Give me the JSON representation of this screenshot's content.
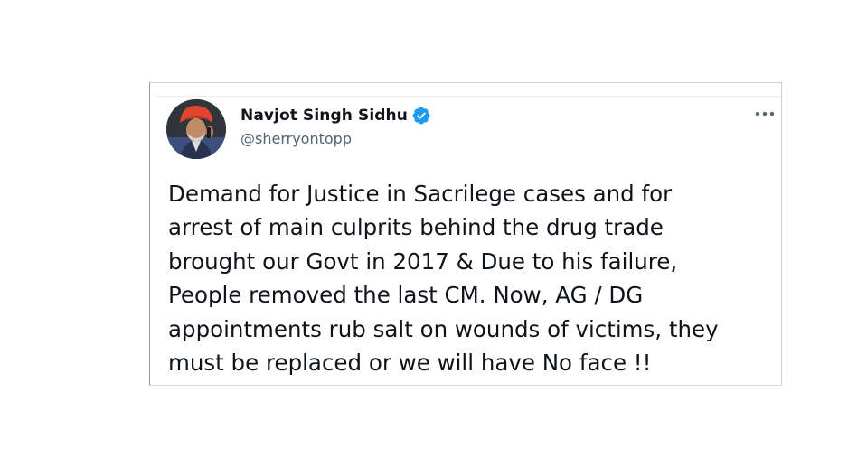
{
  "tweet": {
    "display_name": "Navjot Singh Sidhu",
    "handle": "@sherryontopp",
    "verified": true,
    "lines": [
      "Demand for Justice in Sacrilege cases and for",
      "arrest of main culprits behind the drug trade",
      "brought our Govt in 2017 & Due to his failure,",
      "People removed the last CM. Now, AG / DG",
      "appointments rub salt on wounds of victims, they",
      "must be replaced or we will have No face !!"
    ]
  },
  "icons": {
    "verified": "verified-badge-icon",
    "more": "more-dots-icon"
  },
  "colors": {
    "verified_blue": "#1d9bf0",
    "text_primary": "#0f1419",
    "text_secondary": "#536471",
    "turban": "#e0452e"
  }
}
